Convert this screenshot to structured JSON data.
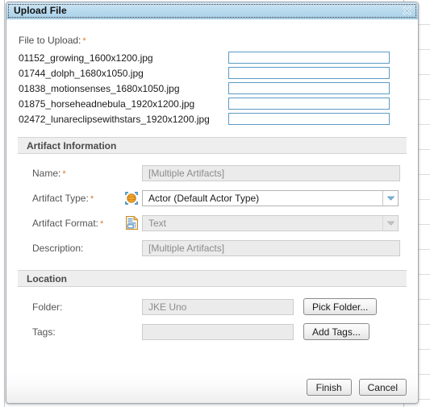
{
  "background": {
    "rows": [
      "20",
      "20",
      "20",
      "20",
      "20",
      "20",
      "20",
      "20",
      "20",
      "20",
      "20",
      "20",
      "20",
      "20",
      "20",
      "20"
    ]
  },
  "dialog": {
    "title": "Upload File",
    "close_icon": "close-icon",
    "file_section": {
      "label": "File to Upload:",
      "required_marker": "*",
      "files": [
        {
          "name": "01152_growing_1600x1200.jpg",
          "value": ""
        },
        {
          "name": "01744_dolph_1680x1050.jpg",
          "value": ""
        },
        {
          "name": "01838_motionsenses_1680x1050.jpg",
          "value": ""
        },
        {
          "name": "01875_horseheadnebula_1920x1200.jpg",
          "value": ""
        },
        {
          "name": "02472_lunareclipsewithstars_1920x1200.jpg",
          "value": ""
        }
      ]
    },
    "artifact_information": {
      "header": "Artifact Information",
      "name": {
        "label": "Name:",
        "required_marker": "*",
        "value": "[Multiple Artifacts]"
      },
      "artifact_type": {
        "label": "Artifact Type:",
        "required_marker": "*",
        "icon": "actor-type-icon",
        "value": "Actor (Default Actor Type)",
        "arrow_icon": "chevron-down-icon"
      },
      "artifact_format": {
        "label": "Artifact Format:",
        "required_marker": "*",
        "icon": "text-document-icon",
        "value": "Text",
        "arrow_icon": "chevron-down-icon"
      },
      "description": {
        "label": "Description:",
        "value": "[Multiple Artifacts]"
      }
    },
    "location": {
      "header": "Location",
      "folder": {
        "label": "Folder:",
        "value": "JKE Uno",
        "button_label": "Pick Folder..."
      },
      "tags": {
        "label": "Tags:",
        "value": "",
        "button_label": "Add Tags..."
      }
    },
    "footer": {
      "finish_label": "Finish",
      "cancel_label": "Cancel"
    }
  },
  "colors": {
    "titlebar_blue": "#bcdcef",
    "required_orange": "#e07a28",
    "input_border_blue": "#5b9bc4",
    "section_gray": "#eeeeee",
    "disabled_text": "#8c8c8c"
  }
}
